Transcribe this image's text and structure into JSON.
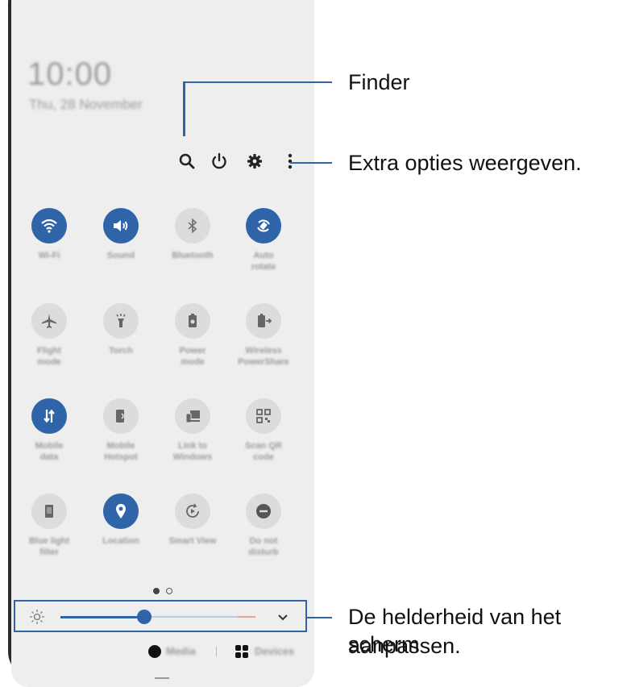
{
  "lock": {
    "time": "10:00",
    "date": "Thu, 28 November"
  },
  "top_icons": [
    "search-icon",
    "power-icon",
    "settings-gear-icon",
    "more-options-icon"
  ],
  "tiles": [
    {
      "label": "Wi-Fi",
      "on": true,
      "icon": "wifi"
    },
    {
      "label": "Sound",
      "on": true,
      "icon": "sound"
    },
    {
      "label": "Bluetooth",
      "on": false,
      "icon": "bluetooth"
    },
    {
      "label": "Auto\nrotate",
      "on": true,
      "icon": "rotate"
    },
    {
      "label": "Flight\nmode",
      "on": false,
      "icon": "flight"
    },
    {
      "label": "Torch",
      "on": false,
      "icon": "torch"
    },
    {
      "label": "Power\nmode",
      "on": false,
      "icon": "power-mode"
    },
    {
      "label": "Wireless\nPowerShare",
      "on": false,
      "icon": "powershare"
    },
    {
      "label": "Mobile\ndata",
      "on": true,
      "icon": "mobile-data"
    },
    {
      "label": "Mobile\nHotspot",
      "on": false,
      "icon": "hotspot"
    },
    {
      "label": "Link to\nWindows",
      "on": false,
      "icon": "link-windows"
    },
    {
      "label": "Scan QR\ncode",
      "on": false,
      "icon": "qr"
    },
    {
      "label": "Blue light\nfilter",
      "on": false,
      "icon": "blue-light"
    },
    {
      "label": "Location",
      "on": true,
      "icon": "location"
    },
    {
      "label": "Smart View",
      "on": false,
      "icon": "smart-view"
    },
    {
      "label": "Do not\ndisturb",
      "on": false,
      "icon": "dnd"
    }
  ],
  "page_indicator": {
    "current": 1,
    "total": 2
  },
  "brightness": {
    "level": 0.4
  },
  "bottom": {
    "media": "Media",
    "devices": "Devices"
  },
  "callouts": {
    "finder": "Finder",
    "extra": "Extra opties weergeven.",
    "brightness_line1": "De helderheid van het scherm",
    "brightness_line2": "aanpassen."
  },
  "colors": {
    "accent": "#2f64a8",
    "panel": "#eeeeee",
    "tile_off": "#dcdcdc"
  }
}
